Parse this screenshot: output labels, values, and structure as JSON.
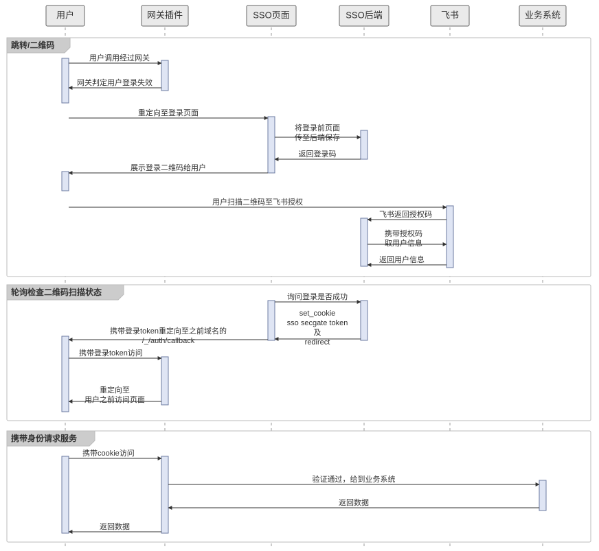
{
  "actors": {
    "user": "用户",
    "gateway": "网关插件",
    "sso_page": "SSO页面",
    "sso_backend": "SSO后端",
    "feishu": "飞书",
    "biz": "业务系统"
  },
  "groups": {
    "g1": "跳转/二维码",
    "g2": "轮询检查二维码扫描状态",
    "g3": "携带身份请求服务"
  },
  "messages": {
    "m1": "用户调用经过网关",
    "m2": "网关判定用户登录失效",
    "m3": "重定向至登录页面",
    "m4a": "将登录前页面",
    "m4b": "传至后端保存",
    "m5": "返回登录码",
    "m6": "展示登录二维码给用户",
    "m7": "用户扫描二维码至飞书授权",
    "m8": "飞书返回授权码",
    "m9a": "携带授权码",
    "m9b": "取用户信息",
    "m10": "返回用户信息",
    "m11": "询问登录是否成功",
    "m12a": "set_cookie",
    "m12b": "sso secgate token",
    "m12c": "及",
    "m12d": "redirect",
    "m13a": "携带登录token重定向至之前域名的",
    "m13b": "/_/auth/callback",
    "m14": "携带登录token访问",
    "m15a": "重定向至",
    "m15b": "用户之前访问页面",
    "m16": "携带cookie访问",
    "m17": "验证通过，给到业务系统",
    "m18": "返回数据",
    "m19": "返回数据"
  },
  "chart_data": {
    "type": "sequence-diagram",
    "participants": [
      "用户",
      "网关插件",
      "SSO页面",
      "SSO后端",
      "飞书",
      "业务系统"
    ],
    "groups": [
      {
        "label": "跳转/二维码",
        "interactions": [
          {
            "from": "用户",
            "to": "网关插件",
            "text": "用户调用经过网关",
            "direction": "request"
          },
          {
            "from": "网关插件",
            "to": "用户",
            "text": "网关判定用户登录失效",
            "direction": "response"
          },
          {
            "from": "用户",
            "to": "SSO页面",
            "text": "重定向至登录页面",
            "direction": "request"
          },
          {
            "from": "SSO页面",
            "to": "SSO后端",
            "text": "将登录前页面 传至后端保存",
            "direction": "request"
          },
          {
            "from": "SSO后端",
            "to": "SSO页面",
            "text": "返回登录码",
            "direction": "response"
          },
          {
            "from": "SSO页面",
            "to": "用户",
            "text": "展示登录二维码给用户",
            "direction": "response"
          },
          {
            "from": "用户",
            "to": "飞书",
            "text": "用户扫描二维码至飞书授权",
            "direction": "request"
          },
          {
            "from": "飞书",
            "to": "SSO后端",
            "text": "飞书返回授权码",
            "direction": "response"
          },
          {
            "from": "SSO后端",
            "to": "飞书",
            "text": "携带授权码 取用户信息",
            "direction": "request"
          },
          {
            "from": "飞书",
            "to": "SSO后端",
            "text": "返回用户信息",
            "direction": "response"
          }
        ]
      },
      {
        "label": "轮询检查二维码扫描状态",
        "interactions": [
          {
            "from": "SSO页面",
            "to": "SSO后端",
            "text": "询问登录是否成功",
            "direction": "request"
          },
          {
            "from": "SSO后端",
            "to": "SSO页面",
            "text": "set_cookie sso secgate token 及 redirect",
            "direction": "response"
          },
          {
            "from": "SSO页面",
            "to": "用户",
            "text": "携带登录token重定向至之前域名的 /_/auth/callback",
            "direction": "response"
          },
          {
            "from": "用户",
            "to": "网关插件",
            "text": "携带登录token访问",
            "direction": "request"
          },
          {
            "from": "网关插件",
            "to": "用户",
            "text": "重定向至 用户之前访问页面",
            "direction": "response"
          }
        ]
      },
      {
        "label": "携带身份请求服务",
        "interactions": [
          {
            "from": "用户",
            "to": "网关插件",
            "text": "携带cookie访问",
            "direction": "request"
          },
          {
            "from": "网关插件",
            "to": "业务系统",
            "text": "验证通过，给到业务系统",
            "direction": "request"
          },
          {
            "from": "业务系统",
            "to": "网关插件",
            "text": "返回数据",
            "direction": "response"
          },
          {
            "from": "网关插件",
            "to": "用户",
            "text": "返回数据",
            "direction": "response"
          }
        ]
      }
    ]
  }
}
